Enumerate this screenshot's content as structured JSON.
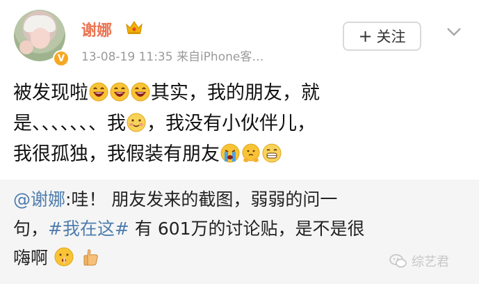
{
  "post": {
    "username": "谢娜",
    "meta": "13-08-19 11:35  来自iPhone客…",
    "follow_label": "关注",
    "lines": {
      "l1_text": "被发现啦",
      "l1_tail": "其实，我的朋友，就",
      "l2_text": "是、、、、、、、我",
      "l2_tail": "，我没有小伙伴儿，",
      "l3_text": "我很孤独，我假装有朋友"
    }
  },
  "repost": {
    "mention": "@谢娜",
    "p1": ":哇！ 朋友发来的截图，弱弱的问一",
    "p2_start": "句，",
    "topic": "#我在这#",
    "p2_end": " 有 601万的讨论贴，是不是很",
    "p3": "嗨啊"
  },
  "watermark": {
    "label": "综艺君"
  },
  "colors": {
    "username": "#eb7350",
    "link": "#4f7dae",
    "badge": "#f7a823"
  }
}
